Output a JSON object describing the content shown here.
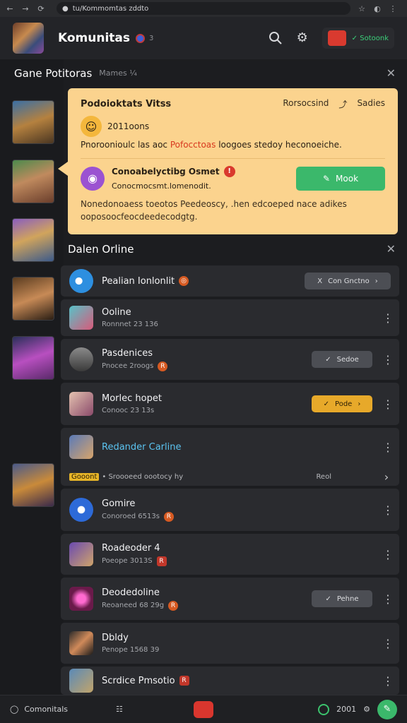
{
  "browser": {
    "back": "←",
    "forward": "→",
    "reload": "⟳",
    "url": "tu/Kommomtas zddto",
    "star": "☆",
    "menu": "⋮"
  },
  "header": {
    "title": "Komunitas",
    "count": "3",
    "live_label": "Sotoonk"
  },
  "game_section": {
    "title": "Gane Potitoras",
    "subtitle": "Mames ¼"
  },
  "notification": {
    "title": "Podoioktats Vitss",
    "action1": "Rorsocsind",
    "action2": "Sadies",
    "badge_text": "2011oons",
    "line_prefix": "Pnoroonioulc las aoc ",
    "line_highlight": "Pofocctoas",
    "line_suffix": " loogoes stedoy heconoeiche.",
    "item_title": "Conoabelyctibg Osmet",
    "item_subtitle": "Conocmocsmt.lomenodit.",
    "button": "Mook",
    "desc_line1": "Nonedonoaess toeotos Peedeoscy, .hen edcoeped nace adikes",
    "desc_line2": "ooposoocfeocdeedecodgtg."
  },
  "online_section": {
    "title": "Dalen Orline"
  },
  "rows": [
    {
      "name": "Pealian Ionlonlit",
      "status": "",
      "button": "Con Gnctno",
      "button_prefix": "X",
      "button_arrow": "›",
      "kebab": false
    },
    {
      "name": "Ooline",
      "status": "Ronnnet 23 136",
      "button": "",
      "kebab": true
    },
    {
      "name": "Pasdenices",
      "status": "Pnocee 2roogs",
      "button": "Sedoe",
      "button_prefix": "✓",
      "kebab": true
    },
    {
      "name": "Morlec hopet",
      "status": "Conooc 23 13s",
      "button": "Pode",
      "button_prefix": "✓",
      "button_arrow": "›",
      "kebab": true
    },
    {
      "name": "Redander Carline",
      "status": "",
      "tag": "Gooont",
      "extra": "• Sroooeed oootocy hy",
      "right_text": "Reol",
      "kebab": true
    },
    {
      "name": "Gomire",
      "status": "Conoroed 6513s",
      "button": "",
      "kebab": true
    },
    {
      "name": "Roadeoder 4",
      "status": "Poeope 3013S",
      "button": "",
      "kebab": true
    },
    {
      "name": "Deodedoline",
      "status": "Reoaneed 68 29g",
      "button": "Pehne",
      "button_prefix": "✓",
      "kebab": true
    },
    {
      "name": "Dbldy",
      "status": "Penope 1568 39",
      "button": "",
      "kebab": true
    },
    {
      "name": "Scrdice Pmsotio",
      "status": "",
      "button": "",
      "kebab": true
    }
  ],
  "bottom": {
    "label": "Comonitals",
    "count": "2001"
  },
  "colors": {
    "background": "#1c1d20",
    "card": "#fbd38e",
    "accent_green": "#3bb86b",
    "accent_red": "#d9392d",
    "accent_orange": "#e7a92a"
  }
}
